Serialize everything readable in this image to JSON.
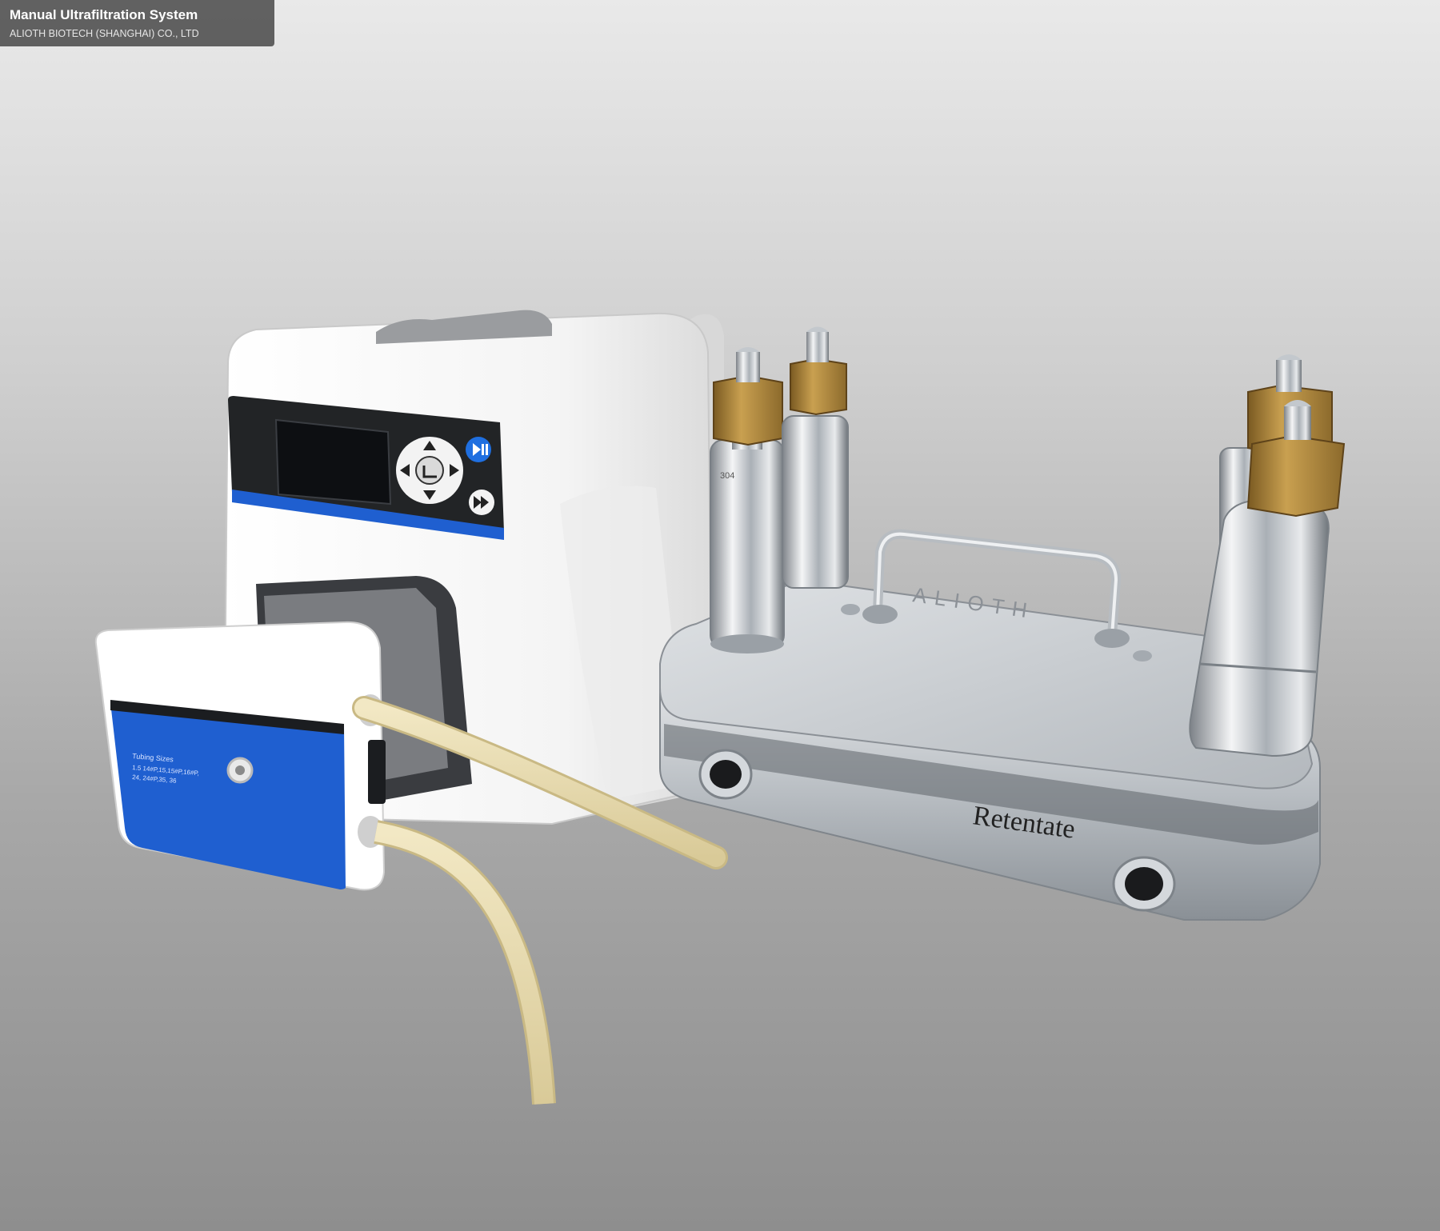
{
  "caption": {
    "title": "Manual Ultrafiltration System",
    "subtitle": "ALIOTH BIOTECH (SHANGHAI) CO., LTD"
  },
  "photo": {
    "pump_label": "Tubing Sizes",
    "pump_label_line1": "1.5 14#P,15,15#P,16#P,",
    "pump_label_line2": "24, 24#P,35, 36",
    "brand_engraving": "ALIOTH",
    "retentate_label": "Retentate",
    "fitting_mark": "304"
  },
  "colors": {
    "pump_blue": "#1f5fd0",
    "tubing": "#e8dcb2",
    "brass": "#b48a3c",
    "steel": "#c8ccd0"
  }
}
